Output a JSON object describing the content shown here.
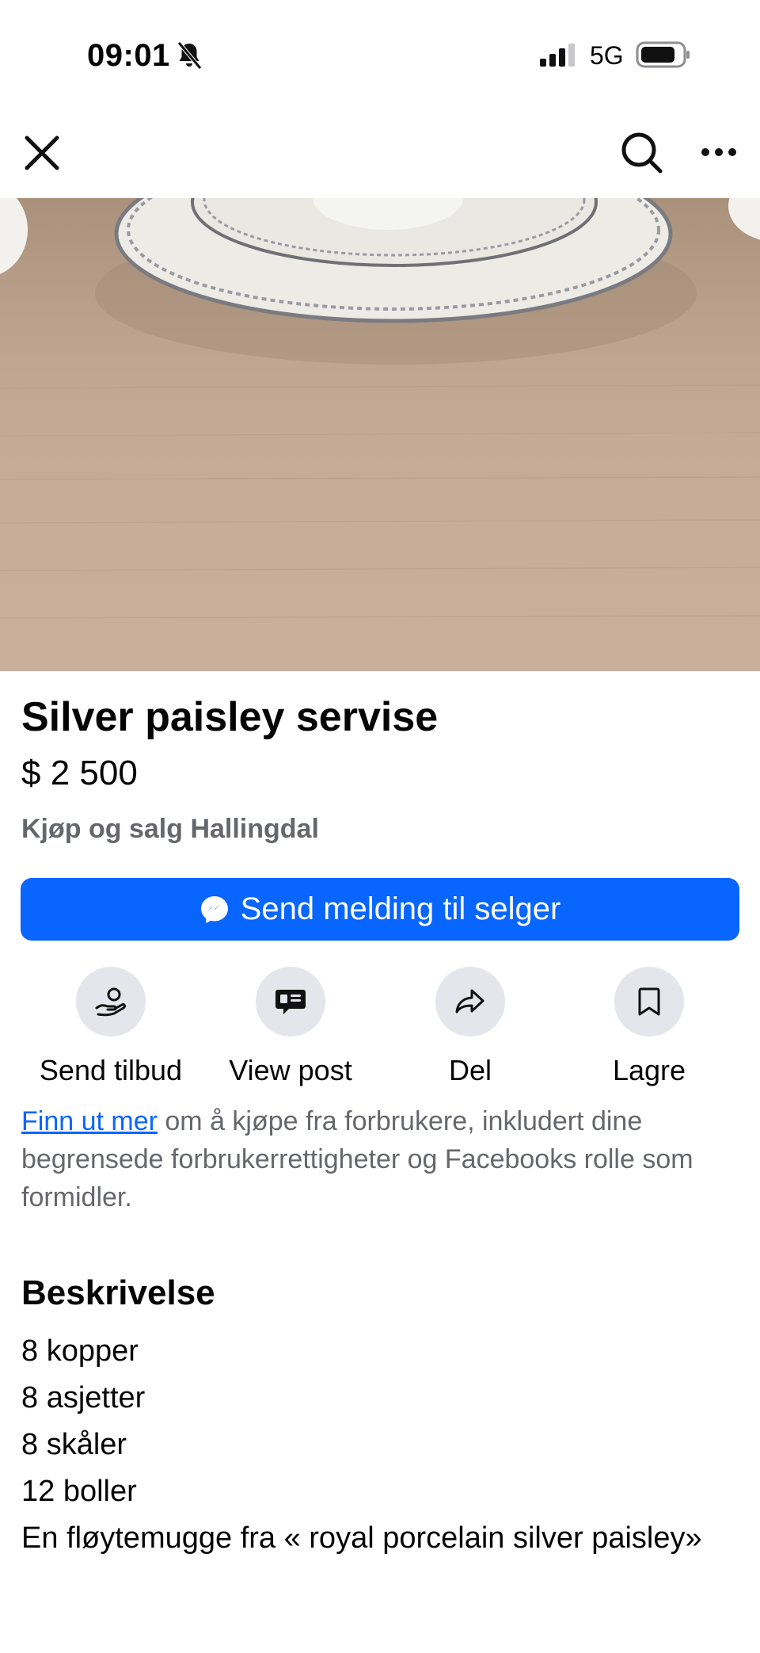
{
  "status_bar": {
    "time": "09:01",
    "network": "5G",
    "icons": [
      "bell-slash-icon",
      "signal-icon",
      "battery-icon"
    ]
  },
  "nav": {
    "icons": [
      "close-icon",
      "search-icon",
      "more-icon"
    ]
  },
  "listing": {
    "title": "Silver paisley servise",
    "price": "$ 2 500",
    "group": "Kjøp og salg Hallingdal"
  },
  "message_button": {
    "label": "Send melding til selger",
    "icon": "messenger-icon",
    "color": "#0866ff"
  },
  "actions": [
    {
      "label": "Send tilbud",
      "icon": "offer-hand-icon"
    },
    {
      "label": "View post",
      "icon": "post-icon"
    },
    {
      "label": "Del",
      "icon": "share-icon"
    },
    {
      "label": "Lagre",
      "icon": "bookmark-icon"
    }
  ],
  "info": {
    "link_text": "Finn ut mer",
    "text": " om å kjøpe fra forbrukere, inkludert dine begrensede forbrukerrettigheter og Facebooks rolle som formidler."
  },
  "description": {
    "heading": "Beskrivelse",
    "lines": [
      "8 kopper",
      "8 asjetter",
      "8 skåler",
      "12 boller",
      "En fløytemugge fra « royal porcelain silver paisley»"
    ]
  },
  "colors": {
    "accent": "#0866ff",
    "secondary_text": "#65676b",
    "action_circle": "#e4e6eb"
  }
}
